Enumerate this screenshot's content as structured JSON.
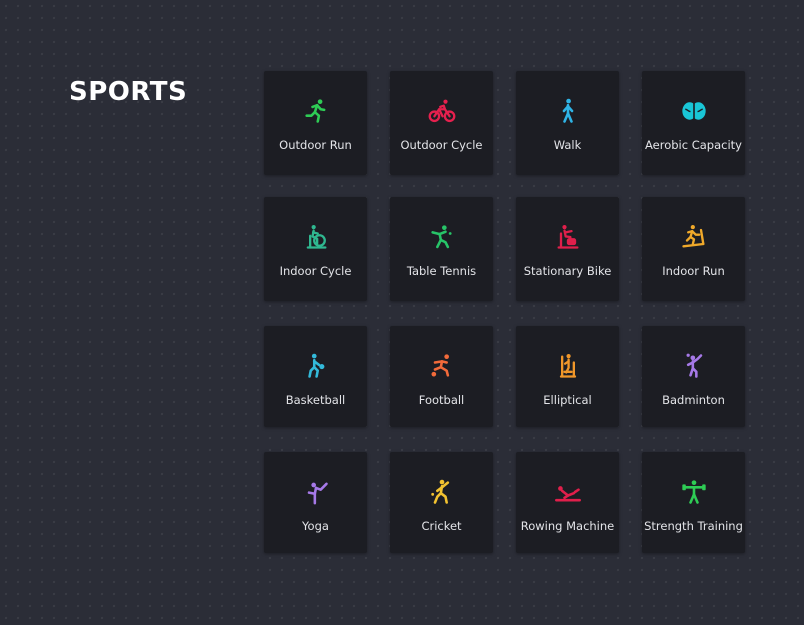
{
  "header": {
    "title": "SPORTS"
  },
  "sports": [
    {
      "label": "Outdoor Run",
      "icon": "outdoor-run-icon",
      "color": "#2ecc55"
    },
    {
      "label": "Outdoor Cycle",
      "icon": "outdoor-cycle-icon",
      "color": "#e6204e"
    },
    {
      "label": "Walk",
      "icon": "walk-icon",
      "color": "#2fb4e6"
    },
    {
      "label": "Aerobic Capacity",
      "icon": "brain-icon",
      "color": "#19c6d6"
    },
    {
      "label": "Indoor Cycle",
      "icon": "indoor-cycle-icon",
      "color": "#2fb890"
    },
    {
      "label": "Table Tennis",
      "icon": "table-tennis-icon",
      "color": "#27c468"
    },
    {
      "label": "Stationary Bike",
      "icon": "stationary-bike-icon",
      "color": "#e01f4b"
    },
    {
      "label": "Indoor Run",
      "icon": "indoor-run-icon",
      "color": "#f0a92a"
    },
    {
      "label": "Basketball",
      "icon": "basketball-icon",
      "color": "#33b9d9"
    },
    {
      "label": "Football",
      "icon": "football-icon",
      "color": "#f26a3a"
    },
    {
      "label": "Elliptical",
      "icon": "elliptical-icon",
      "color": "#f0972a"
    },
    {
      "label": "Badminton",
      "icon": "badminton-icon",
      "color": "#a679e8"
    },
    {
      "label": "Yoga",
      "icon": "yoga-icon",
      "color": "#a679e8"
    },
    {
      "label": "Cricket",
      "icon": "cricket-icon",
      "color": "#f2c230"
    },
    {
      "label": "Rowing Machine",
      "icon": "rowing-machine-icon",
      "color": "#e01f4b"
    },
    {
      "label": "Strength Training",
      "icon": "strength-training-icon",
      "color": "#2ecc55"
    }
  ]
}
